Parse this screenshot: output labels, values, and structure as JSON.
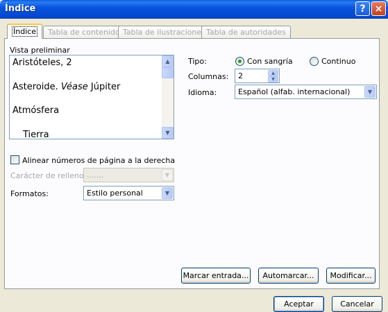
{
  "window": {
    "title": "Índice",
    "help_glyph": "?",
    "close_glyph": "×"
  },
  "tabs": [
    {
      "label": "Índice",
      "active": true
    },
    {
      "label": "Tabla de contenido",
      "active": false
    },
    {
      "label": "Tabla de ilustraciones",
      "active": false
    },
    {
      "label": "Tabla de autoridades",
      "active": false
    }
  ],
  "preview": {
    "label": "Vista preliminar",
    "entries": [
      {
        "text": "Aristóteles, 2"
      },
      {
        "text_before": "Asteroide. ",
        "italic": "Véase",
        "text_after": " Júpiter"
      },
      {
        "text": "Atmósfera"
      },
      {
        "text": "Tierra"
      }
    ]
  },
  "align_right": {
    "label": "Alinear números de página a la derecha",
    "checked": false
  },
  "fill_char": {
    "label": "Carácter de relleno:",
    "value": ".......",
    "enabled": false
  },
  "formats": {
    "label": "Formatos:",
    "value": "Estilo personal"
  },
  "type": {
    "label": "Tipo:",
    "options": [
      {
        "label": "Con sangría",
        "checked": true
      },
      {
        "label": "Continuo",
        "checked": false
      }
    ]
  },
  "columns": {
    "label": "Columnas:",
    "value": "2"
  },
  "language": {
    "label": "Idioma:",
    "value": "Español (alfab. internacional)"
  },
  "buttons": {
    "mark_entry": "Marcar entrada...",
    "automark": "Automarcar...",
    "modify": "Modificar...",
    "accept": "Aceptar",
    "cancel": "Cancelar"
  },
  "colors": {
    "titlebar": "#0854e0",
    "dialog_bg": "#ece9d8",
    "tab_highlight": "#ffc83c",
    "radio_dot": "#21a121"
  },
  "icons": {
    "scroll_up": "▲",
    "scroll_down": "▼",
    "dropdown": "▼",
    "spin_up": "▲",
    "spin_down": "▼"
  }
}
